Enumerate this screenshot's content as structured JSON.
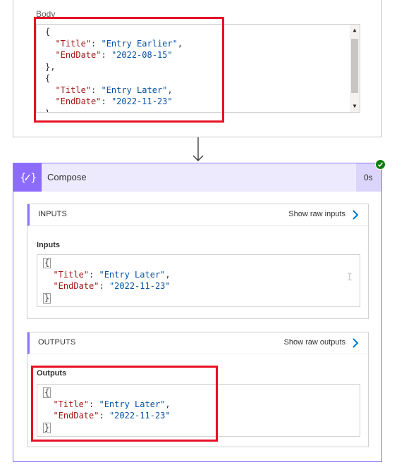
{
  "body_section": {
    "label": "Body",
    "code_lines": [
      [
        {
          "t": "p",
          "v": "{"
        }
      ],
      [
        {
          "t": "p",
          "v": "  "
        },
        {
          "t": "k",
          "v": "\"Title\""
        },
        {
          "t": "p",
          "v": ": "
        },
        {
          "t": "s",
          "v": "\"Entry Earlier\""
        },
        {
          "t": "p",
          "v": ","
        }
      ],
      [
        {
          "t": "p",
          "v": "  "
        },
        {
          "t": "k",
          "v": "\"EndDate\""
        },
        {
          "t": "p",
          "v": ": "
        },
        {
          "t": "s",
          "v": "\"2022-08-15\""
        }
      ],
      [
        {
          "t": "p",
          "v": "},"
        }
      ],
      [
        {
          "t": "p",
          "v": "{"
        }
      ],
      [
        {
          "t": "p",
          "v": "  "
        },
        {
          "t": "k",
          "v": "\"Title\""
        },
        {
          "t": "p",
          "v": ": "
        },
        {
          "t": "s",
          "v": "\"Entry Later\""
        },
        {
          "t": "p",
          "v": ","
        }
      ],
      [
        {
          "t": "p",
          "v": "  "
        },
        {
          "t": "k",
          "v": "\"EndDate\""
        },
        {
          "t": "p",
          "v": ": "
        },
        {
          "t": "s",
          "v": "\"2022-11-23\""
        }
      ],
      [
        {
          "t": "p",
          "v": "}"
        }
      ]
    ]
  },
  "compose": {
    "title": "Compose",
    "duration": "0s",
    "status_color": "#107c10",
    "accent_color": "#8c6cff",
    "inputs": {
      "section_title": "INPUTS",
      "raw_link": "Show raw inputs",
      "label": "Inputs",
      "code_lines": [
        [
          {
            "t": "b",
            "v": "{"
          }
        ],
        [
          {
            "t": "p",
            "v": "  "
          },
          {
            "t": "k",
            "v": "\"Title\""
          },
          {
            "t": "p",
            "v": ": "
          },
          {
            "t": "s",
            "v": "\"Entry Later\""
          },
          {
            "t": "p",
            "v": ","
          }
        ],
        [
          {
            "t": "p",
            "v": "  "
          },
          {
            "t": "k",
            "v": "\"EndDate\""
          },
          {
            "t": "p",
            "v": ": "
          },
          {
            "t": "s",
            "v": "\"2022-11-23\""
          }
        ],
        [
          {
            "t": "b",
            "v": "}"
          }
        ]
      ]
    },
    "outputs": {
      "section_title": "OUTPUTS",
      "raw_link": "Show raw outputs",
      "label": "Outputs",
      "code_lines": [
        [
          {
            "t": "b",
            "v": "{"
          }
        ],
        [
          {
            "t": "p",
            "v": "  "
          },
          {
            "t": "k",
            "v": "\"Title\""
          },
          {
            "t": "p",
            "v": ": "
          },
          {
            "t": "s",
            "v": "\"Entry Later\""
          },
          {
            "t": "p",
            "v": ","
          }
        ],
        [
          {
            "t": "p",
            "v": "  "
          },
          {
            "t": "k",
            "v": "\"EndDate\""
          },
          {
            "t": "p",
            "v": ": "
          },
          {
            "t": "s",
            "v": "\"2022-11-23\""
          }
        ],
        [
          {
            "t": "b",
            "v": "}"
          }
        ]
      ]
    }
  },
  "highlight_color": "#e81123"
}
